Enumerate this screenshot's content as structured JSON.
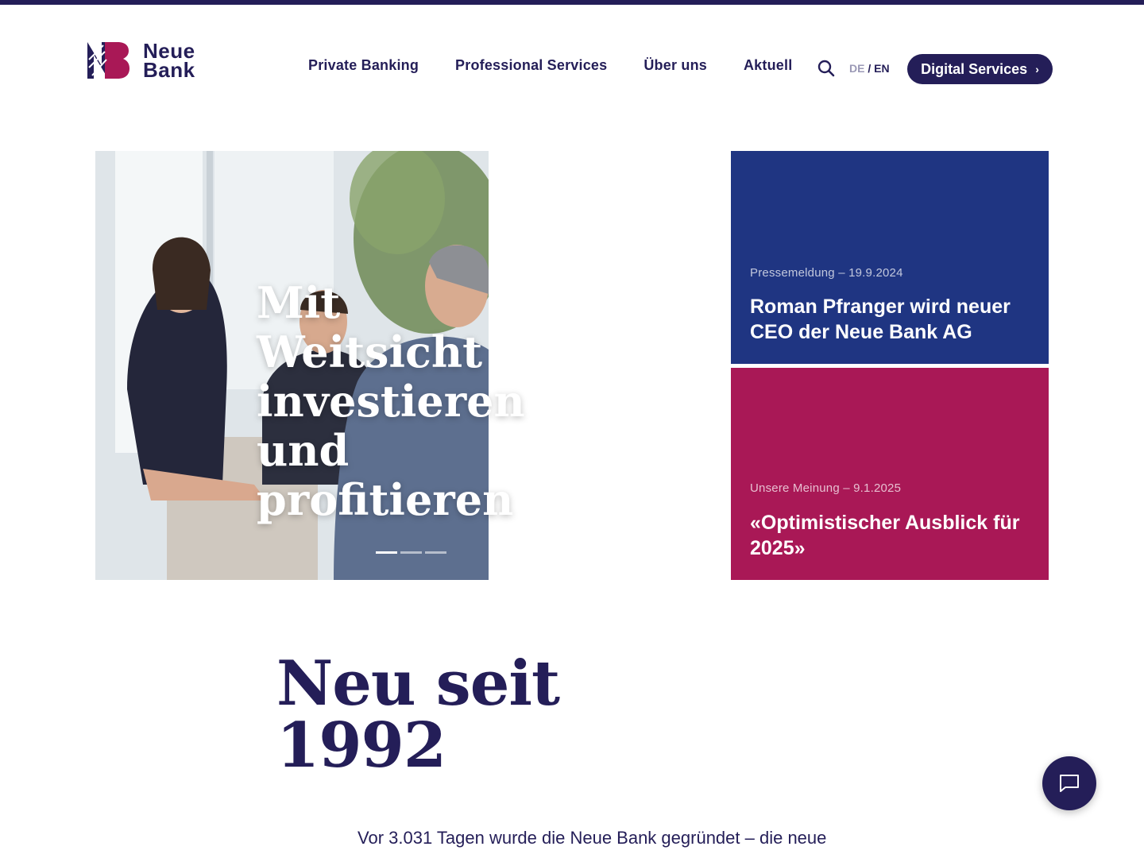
{
  "brand": {
    "name_line1": "Neue",
    "name_line2": "Bank",
    "colors": {
      "navy": "#241e58",
      "crimson": "#a91856",
      "royal": "#1f3582"
    }
  },
  "nav": {
    "items": [
      {
        "label": "Private Banking"
      },
      {
        "label": "Professional Services"
      },
      {
        "label": "Über uns"
      },
      {
        "label": "Aktuell"
      }
    ],
    "search_icon": "search-icon",
    "lang": {
      "de": "DE",
      "separator": "/",
      "en": "EN",
      "active": "EN"
    },
    "cta": {
      "label": "Digital Services",
      "icon": "chevron-right-icon"
    }
  },
  "hero": {
    "title_lines": [
      "Mit",
      "Weitsicht",
      "investieren",
      "und",
      "profitieren"
    ],
    "slides_total": 3,
    "active_slide": 1
  },
  "news": [
    {
      "meta": "Pressemeldung – 19.9.2024",
      "headline": "Roman Pfranger wird neuer CEO der Neue Bank AG",
      "color": "#1f3582"
    },
    {
      "meta": "Unsere Meinung – 9.1.2025",
      "headline": "«Optimistischer Ausblick für 2025»",
      "color": "#a91856"
    }
  ],
  "section": {
    "title_line1": "Neu seit",
    "title_line2": "1992",
    "text": "Vor 3.031 Tagen wurde die Neue Bank gegründet – die neue"
  },
  "chat": {
    "icon": "chat-icon"
  }
}
